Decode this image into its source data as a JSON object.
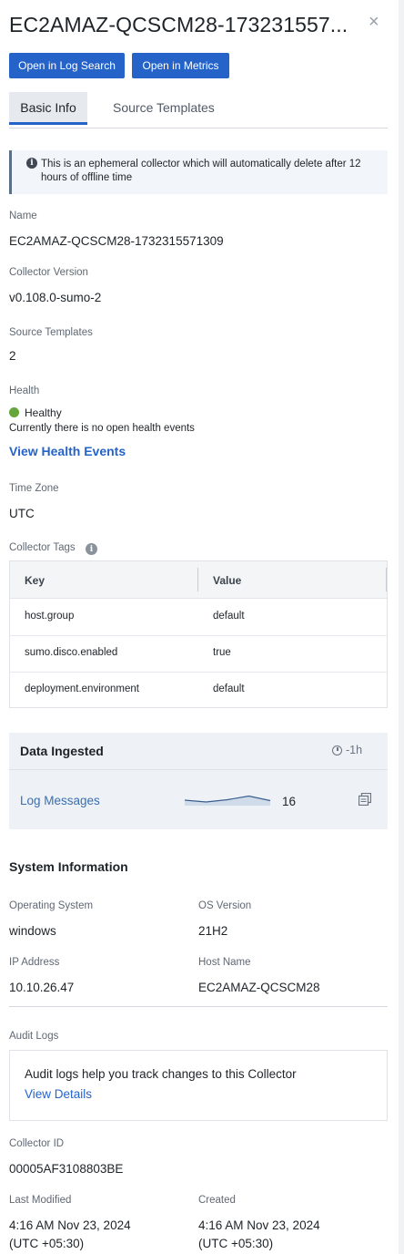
{
  "header": {
    "title": "EC2AMAZ-QCSCM28-173231557...",
    "close_label": "×",
    "log_search_label": "Open in Log Search",
    "metrics_label": "Open in Metrics"
  },
  "tabs": [
    {
      "label": "Basic Info",
      "active": true
    },
    {
      "label": "Source Templates",
      "active": false
    }
  ],
  "notice": {
    "icon": "info-icon",
    "text": "This is an ephemeral collector which will automatically delete after 12 hours of offline time"
  },
  "details": {
    "name_label": "Name",
    "name_value": "EC2AMAZ-QCSCM28-1732315571309",
    "version_label": "Collector Version",
    "version_value": "v0.108.0-sumo-2",
    "templates_label": "Source Templates",
    "templates_value": "2",
    "health_label": "Health",
    "health_status": "Healthy",
    "health_status_color": "#64a63a",
    "health_note": "Currently there is no open health events",
    "health_link": "View Health Events",
    "timezone_label": "Time Zone",
    "timezone_value": "UTC",
    "tags_label": "Collector Tags"
  },
  "tags_table": {
    "key_header": "Key",
    "value_header": "Value",
    "rows": [
      {
        "key": "host.group",
        "value": "default"
      },
      {
        "key": "sumo.disco.enabled",
        "value": "true"
      },
      {
        "key": "deployment.environment",
        "value": "default"
      }
    ]
  },
  "data_ingested": {
    "title": "Data Ingested",
    "time_range": "-1h",
    "metric_label": "Log Messages",
    "count": "16",
    "sparkline": [
      0.5,
      0.3,
      0.55,
      0.95,
      0.45
    ]
  },
  "system": {
    "title": "System Information",
    "os_label": "Operating System",
    "os_value": "windows",
    "osver_label": "OS Version",
    "osver_value": "21H2",
    "ip_label": "IP Address",
    "ip_value": "10.10.26.47",
    "host_label": "Host Name",
    "host_value": "EC2AMAZ-QCSCM28"
  },
  "audit": {
    "label": "Audit Logs",
    "text": "Audit logs help you track changes to this Collector",
    "link": "View Details"
  },
  "meta": {
    "id_label": "Collector ID",
    "id_value": "00005AF3108803BE",
    "modified_label": "Last Modified",
    "modified_time": "4:16 AM Nov 23, 2024",
    "modified_tz": "(UTC +05:30)",
    "created_label": "Created",
    "created_time": "4:16 AM Nov 23, 2024",
    "created_tz": "(UTC +05:30)"
  }
}
